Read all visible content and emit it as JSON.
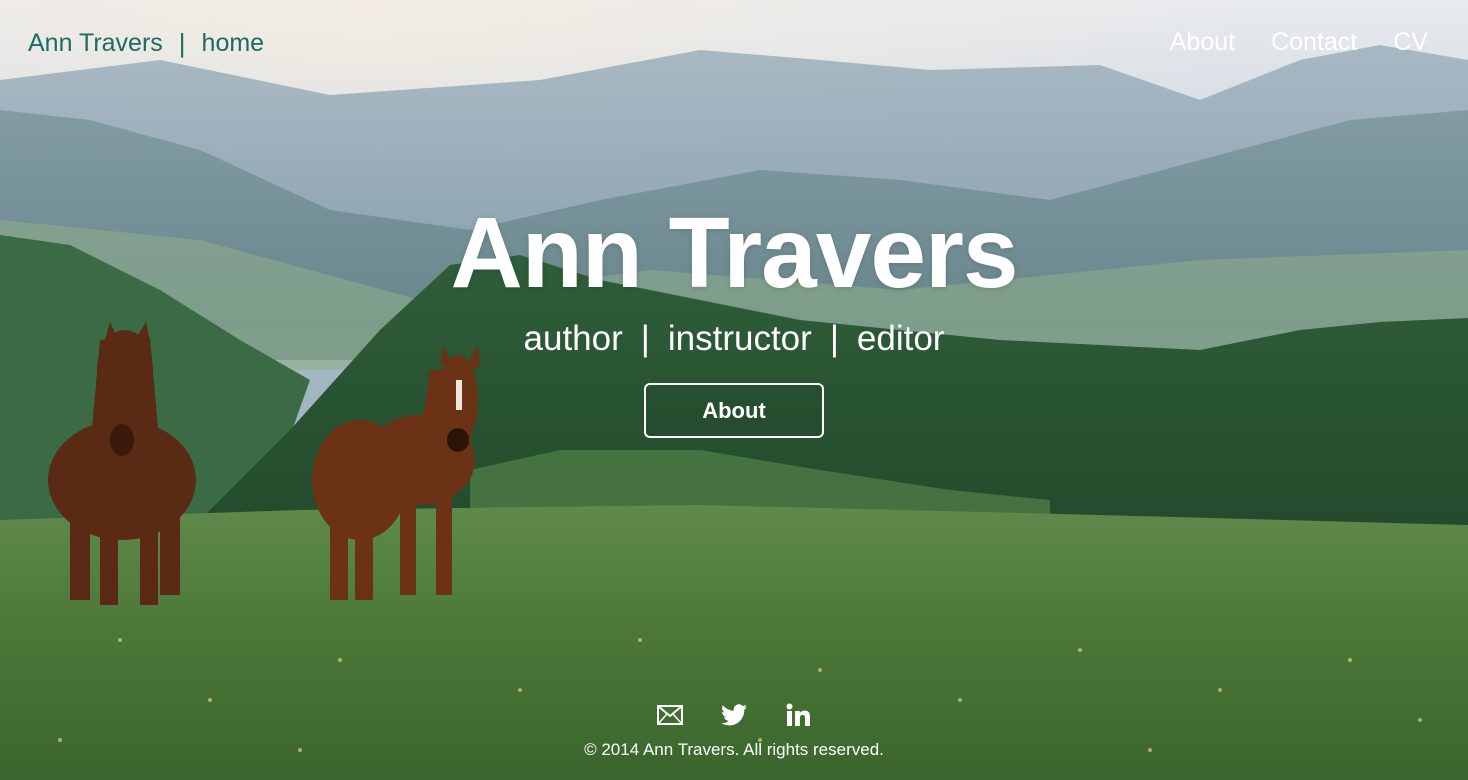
{
  "nav": {
    "brand": "Ann Travers",
    "separator": "|",
    "home": "home",
    "links": [
      "About",
      "Contact",
      "CV"
    ]
  },
  "hero": {
    "title": "Ann Travers",
    "roles": [
      "author",
      "instructor",
      "editor"
    ],
    "role_separator": "|",
    "button": "About"
  },
  "footer": {
    "icons": [
      "envelope-icon",
      "twitter-icon",
      "linkedin-icon"
    ],
    "copyright": "© 2014 Ann Travers. All rights reserved."
  },
  "colors": {
    "brand_text": "#1d6b63",
    "nav_text": "#ffffff",
    "hero_text": "#ffffff"
  }
}
